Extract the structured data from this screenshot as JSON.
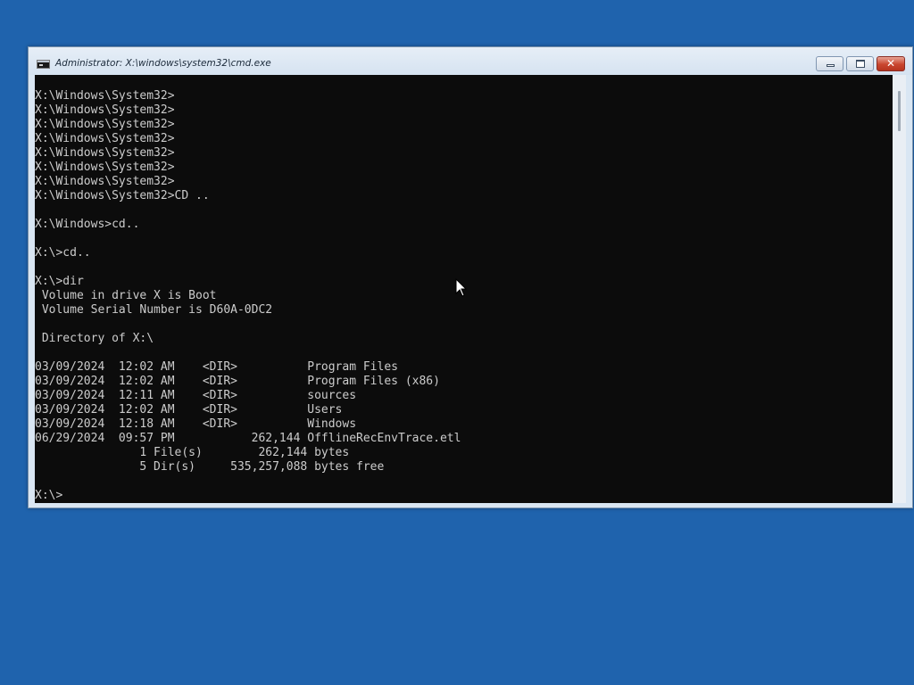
{
  "window": {
    "title": "Administrator: X:\\windows\\system32\\cmd.exe",
    "close_glyph": "✕"
  },
  "console": {
    "lines": [
      "X:\\Windows\\System32>",
      "X:\\Windows\\System32>",
      "X:\\Windows\\System32>",
      "X:\\Windows\\System32>",
      "X:\\Windows\\System32>",
      "X:\\Windows\\System32>",
      "X:\\Windows\\System32>",
      "X:\\Windows\\System32>CD ..",
      "",
      "X:\\Windows>cd..",
      "",
      "X:\\>cd..",
      "",
      "X:\\>dir",
      " Volume in drive X is Boot",
      " Volume Serial Number is D60A-0DC2",
      "",
      " Directory of X:\\",
      "",
      "03/09/2024  12:02 AM    <DIR>          Program Files",
      "03/09/2024  12:02 AM    <DIR>          Program Files (x86)",
      "03/09/2024  12:11 AM    <DIR>          sources",
      "03/09/2024  12:02 AM    <DIR>          Users",
      "03/09/2024  12:18 AM    <DIR>          Windows",
      "06/29/2024  09:57 PM           262,144 OfflineRecEnvTrace.etl",
      "               1 File(s)        262,144 bytes",
      "               5 Dir(s)     535,257,088 bytes free",
      "",
      "X:\\>"
    ]
  },
  "colors": {
    "desktop": "#1f63ad",
    "console_bg": "#0c0c0c",
    "console_text": "#cccccc"
  },
  "icons": {
    "app": "cmd-icon",
    "minimize": "minimize-icon",
    "maximize": "maximize-icon",
    "close": "close-icon",
    "pointer": "mouse-pointer-icon"
  }
}
